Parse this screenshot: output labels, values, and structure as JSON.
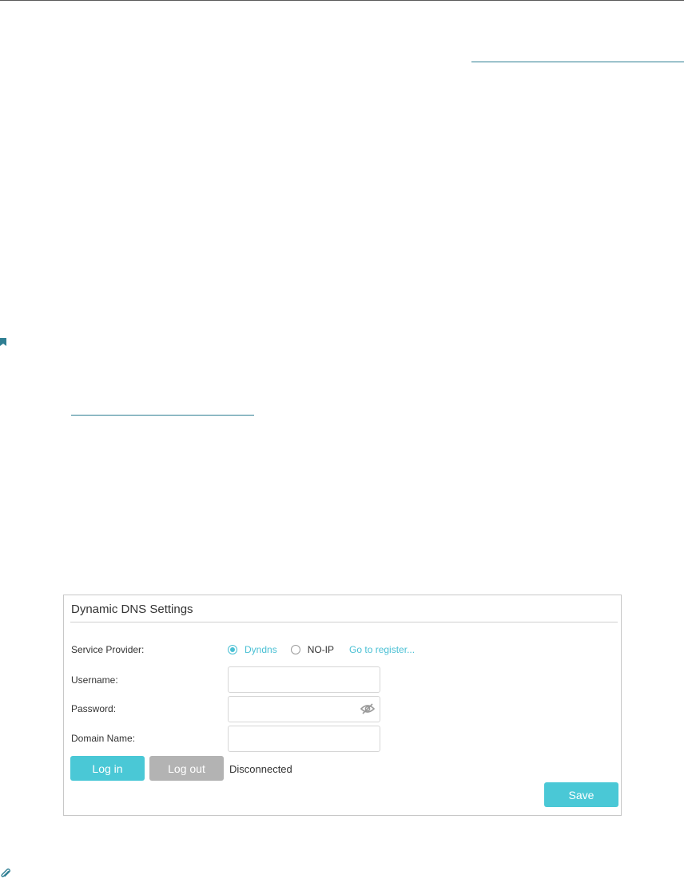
{
  "panel": {
    "title": "Dynamic DNS Settings",
    "service_provider": {
      "label": "Service Provider:",
      "options": [
        {
          "label": "Dyndns",
          "selected": true
        },
        {
          "label": "NO-IP",
          "selected": false
        }
      ],
      "register_link": "Go to register..."
    },
    "username": {
      "label": "Username:",
      "value": "",
      "placeholder": ""
    },
    "password": {
      "label": "Password:",
      "value": "",
      "placeholder": "",
      "toggle_icon": "eye-off-icon"
    },
    "domain_name": {
      "label": "Domain Name:",
      "value": "",
      "placeholder": ""
    },
    "login_label": "Log in",
    "logout_label": "Log out",
    "status": "Disconnected",
    "save_label": "Save"
  },
  "colors": {
    "accent": "#4ac8d6",
    "disabled_button": "#b3b3b3",
    "link": "#2f7f93"
  }
}
